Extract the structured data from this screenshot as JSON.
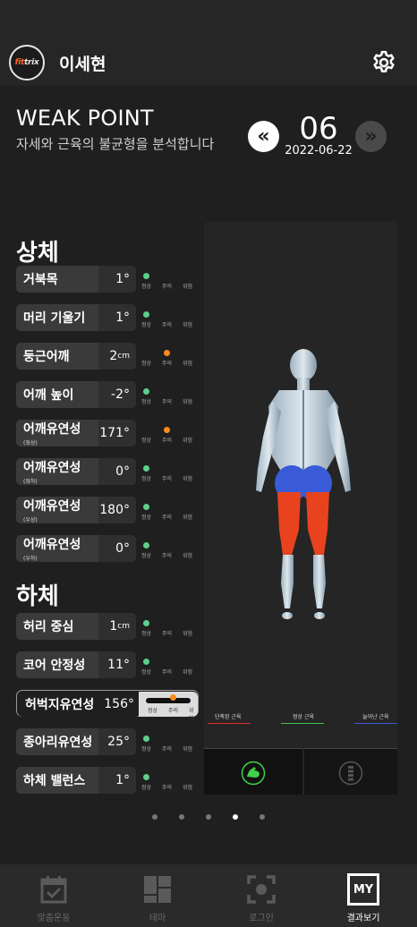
{
  "header": {
    "logo_text": "fittrix",
    "username": "이세현",
    "settings_icon": "gear-icon"
  },
  "title": "WEAK POINT",
  "subtitle": "자세와 근육의 불균형을 분석합니다",
  "date_nav": {
    "prev_icon": "double-chevron-left-icon",
    "next_icon": "double-chevron-right-icon",
    "day": "06",
    "date": "2022-06-22"
  },
  "status_labels": [
    "정상",
    "주의",
    "위험"
  ],
  "colors": {
    "normal": "#5ccf8a",
    "caution": "#ff8a1e",
    "danger": "#e03030",
    "short_muscle": "#e03030",
    "normal_muscle": "#3fbf4a",
    "long_muscle": "#3a5bd8"
  },
  "upper": {
    "title": "상체",
    "items": [
      {
        "name": "거북목",
        "sub": "",
        "value": "1°",
        "unit": "",
        "status": "정상"
      },
      {
        "name": "머리 기울기",
        "sub": "",
        "value": "1°",
        "unit": "",
        "status": "정상"
      },
      {
        "name": "둥근어깨",
        "sub": "",
        "value": "2",
        "unit": "cm",
        "status": "주의"
      },
      {
        "name": "어깨 높이",
        "sub": "",
        "value": "-2°",
        "unit": "",
        "status": "정상"
      },
      {
        "name": "어깨유연성",
        "sub": "(좌상)",
        "value": "171°",
        "unit": "",
        "status": "주의"
      },
      {
        "name": "어깨유연성",
        "sub": "(좌하)",
        "value": "0°",
        "unit": "",
        "status": "정상"
      },
      {
        "name": "어깨유연성",
        "sub": "(우상)",
        "value": "180°",
        "unit": "",
        "status": "정상"
      },
      {
        "name": "어깨유연성",
        "sub": "(우하)",
        "value": "0°",
        "unit": "",
        "status": "정상"
      }
    ]
  },
  "lower": {
    "title": "하체",
    "items": [
      {
        "name": "허리 중심",
        "sub": "",
        "value": "1",
        "unit": "cm",
        "status": "정상"
      },
      {
        "name": "코어 안정성",
        "sub": "",
        "value": "11°",
        "unit": "",
        "status": "정상"
      },
      {
        "name": "허벅지유연성",
        "sub": "",
        "value": "156°",
        "unit": "",
        "status": "주의",
        "selected": true
      },
      {
        "name": "종아리유연성",
        "sub": "",
        "value": "25°",
        "unit": "",
        "status": "정상"
      },
      {
        "name": "하체 밸런스",
        "sub": "",
        "value": "1°",
        "unit": "",
        "status": "정상"
      }
    ]
  },
  "figure": {
    "legend": [
      "단축된 근육",
      "정상 근육",
      "늘어난 근육"
    ],
    "tabs": [
      "muscle-flex-icon",
      "spine-icon"
    ]
  },
  "pager": {
    "count": 5,
    "active_index": 3
  },
  "bottom_nav": [
    {
      "label": "맞춤운동",
      "icon": "calendar-check-icon",
      "active": false
    },
    {
      "label": "테마",
      "icon": "grid-icon",
      "active": false
    },
    {
      "label": "로그인",
      "icon": "scan-frame-icon",
      "active": false
    },
    {
      "label": "결과보기",
      "icon": "my-icon",
      "icon_text": "MY",
      "active": true
    }
  ]
}
